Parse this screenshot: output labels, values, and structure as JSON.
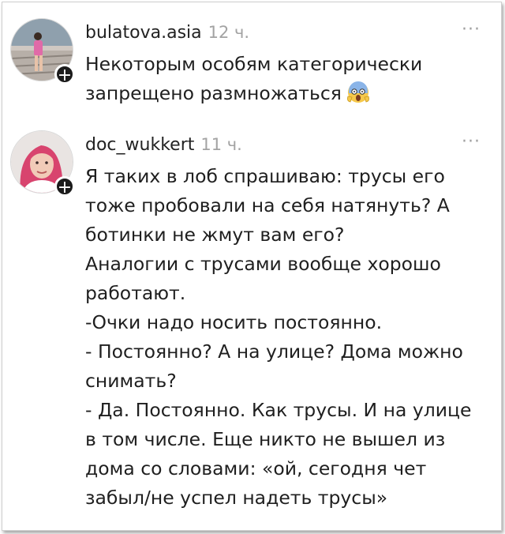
{
  "posts": [
    {
      "author": "bulatova.asia",
      "time": "12 ч.",
      "more": "···",
      "lines": [
        "Некоторым особям категорически",
        "запрещено размножаться"
      ],
      "emoji": "face-screaming-in-fear"
    },
    {
      "author": "doc_wukkert",
      "time": "11 ч.",
      "more": "···",
      "lines": [
        "Я таких в лоб спрашиваю: трусы его",
        "тоже пробовали на себя натянуть? А",
        "ботинки не жмут вам его?",
        "Аналогии с трусами вообще хорошо",
        "работают.",
        "-Очки надо носить постоянно.",
        "- Постоянно? А на улице? Дома можно",
        "снимать?",
        "- Да. Постоянно. Как трусы. И на улице",
        "в том числе. Еще никто не вышел из",
        "дома со словами: «ой, сегодня чет",
        "забыл/не успел надеть трусы»"
      ]
    }
  ],
  "follow_label": "+",
  "colors": {
    "text": "#1f1f1f",
    "muted": "#a3a3a3",
    "follow_badge": "#1b1b1b"
  }
}
